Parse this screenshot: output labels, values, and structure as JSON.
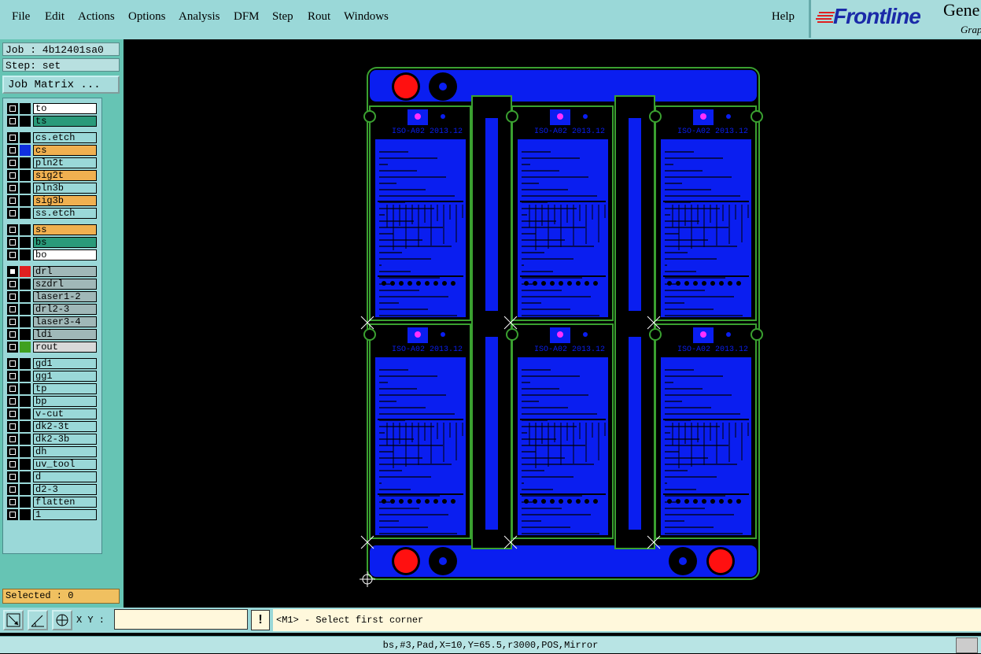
{
  "menu": [
    {
      "key": "file",
      "label": "File"
    },
    {
      "key": "edit",
      "label": "Edit"
    },
    {
      "key": "actions",
      "label": "Actions"
    },
    {
      "key": "options",
      "label": "Options"
    },
    {
      "key": "analysis",
      "label": "Analysis"
    },
    {
      "key": "dfm",
      "label": "DFM"
    },
    {
      "key": "step",
      "label": "Step"
    },
    {
      "key": "rout",
      "label": "Rout"
    },
    {
      "key": "windows",
      "label": "Windows"
    }
  ],
  "help_label": "Help",
  "logo": {
    "brand": "Frontline",
    "product": "Gene",
    "sub": "Grap"
  },
  "job": {
    "job_label": "Job : 4b12401sa0",
    "step_label": "Step: set"
  },
  "job_matrix_label": "Job Matrix ...",
  "layers": [
    {
      "name": "to",
      "color": "#ffffff",
      "swatch": "#000000"
    },
    {
      "name": "ts",
      "color": "#2a9a7a",
      "swatch": "#000000"
    },
    {
      "name": "cs.etch",
      "color": "#9ad8d8",
      "swatch": "#000000",
      "gap": true
    },
    {
      "name": "cs",
      "color": "#f0b050",
      "swatch": "#1030e0"
    },
    {
      "name": "pln2t",
      "color": "#9ad8d8",
      "swatch": "#000000"
    },
    {
      "name": "sig2t",
      "color": "#f0b050",
      "swatch": "#000000"
    },
    {
      "name": "pln3b",
      "color": "#9ad8d8",
      "swatch": "#000000"
    },
    {
      "name": "sig3b",
      "color": "#f0b050",
      "swatch": "#000000"
    },
    {
      "name": "ss.etch",
      "color": "#9ad8d8",
      "swatch": "#000000"
    },
    {
      "name": "ss",
      "color": "#f0b050",
      "swatch": "#000000",
      "gap": true
    },
    {
      "name": "bs",
      "color": "#2a9a7a",
      "swatch": "#000000"
    },
    {
      "name": "bo",
      "color": "#ffffff",
      "swatch": "#000000"
    },
    {
      "name": "drl",
      "color": "#a0b8b8",
      "swatch": "#e02020",
      "gap": true,
      "selected": true
    },
    {
      "name": "szdrl",
      "color": "#a0b8b8",
      "swatch": "#000000"
    },
    {
      "name": "laser1-2",
      "color": "#a0b8b8",
      "swatch": "#000000"
    },
    {
      "name": "drl2-3",
      "color": "#a0b8b8",
      "swatch": "#000000"
    },
    {
      "name": "laser3-4",
      "color": "#a0b8b8",
      "swatch": "#000000"
    },
    {
      "name": "ldi",
      "color": "#a0b8b8",
      "swatch": "#000000"
    },
    {
      "name": "rout",
      "color": "#d8d8d8",
      "swatch": "#40a020"
    },
    {
      "name": "gd1",
      "color": "#9ad8d8",
      "swatch": "#000000",
      "gap": true
    },
    {
      "name": "gg1",
      "color": "#9ad8d8",
      "swatch": "#000000"
    },
    {
      "name": "tp",
      "color": "#9ad8d8",
      "swatch": "#000000"
    },
    {
      "name": "bp",
      "color": "#9ad8d8",
      "swatch": "#000000"
    },
    {
      "name": "v-cut",
      "color": "#9ad8d8",
      "swatch": "#000000"
    },
    {
      "name": "dk2-3t",
      "color": "#9ad8d8",
      "swatch": "#000000"
    },
    {
      "name": "dk2-3b",
      "color": "#9ad8d8",
      "swatch": "#000000"
    },
    {
      "name": "dh",
      "color": "#9ad8d8",
      "swatch": "#000000"
    },
    {
      "name": "uv_tool",
      "color": "#9ad8d8",
      "swatch": "#000000"
    },
    {
      "name": "d",
      "color": "#9ad8d8",
      "swatch": "#000000"
    },
    {
      "name": "d2-3",
      "color": "#9ad8d8",
      "swatch": "#000000"
    },
    {
      "name": "flatten",
      "color": "#9ad8d8",
      "swatch": "#000000"
    },
    {
      "name": "1",
      "color": "#9ad8d8",
      "swatch": "#000000"
    }
  ],
  "selected_label": "Selected : 0",
  "xy_label": "X Y :",
  "xy_value": "",
  "excl_label": "!",
  "prompt_text": "<M1> - Select first corner",
  "status_text": "bs,#3,Pad,X=10,Y=65.5,r3000,POS,Mirror",
  "board": {
    "marking": "ISO-A02 2013.12",
    "copper_color": "#0a1ef0",
    "outline_color": "#3aa030",
    "fiducial_color": "#ff1010",
    "pad_color": "#ff30ff"
  }
}
